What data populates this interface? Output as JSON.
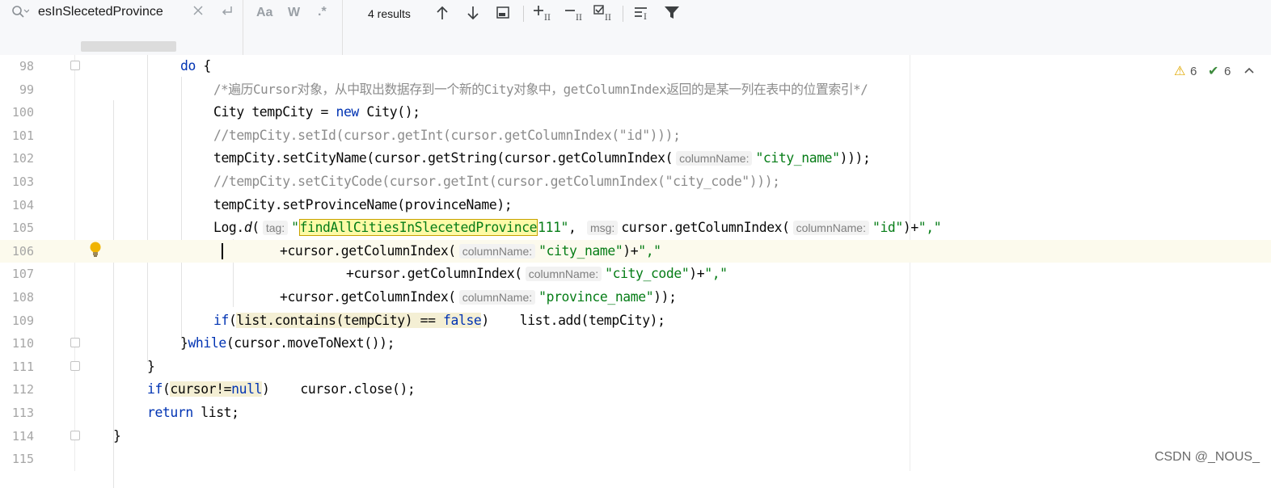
{
  "find": {
    "query": "esInSlecetedProvince",
    "results": "4 results",
    "options": {
      "match_case": "Aa",
      "words": "W",
      "regex": ".*"
    }
  },
  "inspections": {
    "warnings": "6",
    "typos": "6"
  },
  "watermark": "CSDN @_NOUS_",
  "line_numbers": [
    "98",
    "99",
    "100",
    "101",
    "102",
    "103",
    "104",
    "105",
    "106",
    "107",
    "108",
    "109",
    "110",
    "111",
    "112",
    "113",
    "114",
    "115"
  ],
  "code": {
    "l98_kw": "do",
    "l98_rest": " {",
    "l99": "/*遍历Cursor对象，从中取出数据存到一个新的City对象中，getColumnIndex返回的是某一列在表中的位置索引*/",
    "l100_a": "City tempCity = ",
    "l100_kw": "new",
    "l100_b": " City();",
    "l101": "//tempCity.setId(cursor.getInt(cursor.getColumnIndex(\"id\")));",
    "l102_a": "tempCity.setCityName(cursor.getString(cursor.getColumnIndex(",
    "l102_hint": "columnName:",
    "l102_str": "\"city_name\"",
    "l102_b": ")));",
    "l103": "//tempCity.setCityCode(cursor.getInt(cursor.getColumnIndex(\"city_code\")));",
    "l104": "tempCity.setProvinceName(provinceName);",
    "l105_a": "Log.",
    "l105_d": "d",
    "l105_b": "(",
    "l105_hint1": "tag:",
    "l105_q": "\"",
    "l105_match": "findAllCitiesInSlecetedProvince",
    "l105_str_rest": "111\"",
    "l105_c": ", ",
    "l105_hint2": "msg:",
    "l105_d2": "cursor.getColumnIndex(",
    "l105_hint3": "columnName:",
    "l105_str2": "\"id\"",
    "l105_e": ")+",
    "l105_str3": "\",\"",
    "l106_a": "+cursor.getColumnIndex(",
    "l106_hint": "columnName:",
    "l106_str": "\"city_name\"",
    "l106_b": ")+",
    "l106_str2": "\",\"",
    "l107_a": "+cursor.getColumnIndex(",
    "l107_hint": "columnName:",
    "l107_str": "\"city_code\"",
    "l107_b": ")+",
    "l107_str2": "\",\"",
    "l108_a": "+cursor.getColumnIndex(",
    "l108_hint": "columnName:",
    "l108_str": "\"province_name\"",
    "l108_b": "));",
    "l109_kw": "if",
    "l109_p": "(",
    "l109_cond": "list.contains(tempCity) == ",
    "l109_false": "false",
    "l109_p2": ")",
    "l109_rest": "    list.add(tempCity);",
    "l110_a": "}",
    "l110_kw": "while",
    "l110_b": "(cursor.moveToNext());",
    "l111": "}",
    "l112_kw": "if",
    "l112_p": "(",
    "l112_cond": "cursor!=",
    "l112_null": "null",
    "l112_p2": ")",
    "l112_rest": "    cursor.close();",
    "l113_kw": "return",
    "l113_rest": " list;",
    "l114": "}"
  }
}
